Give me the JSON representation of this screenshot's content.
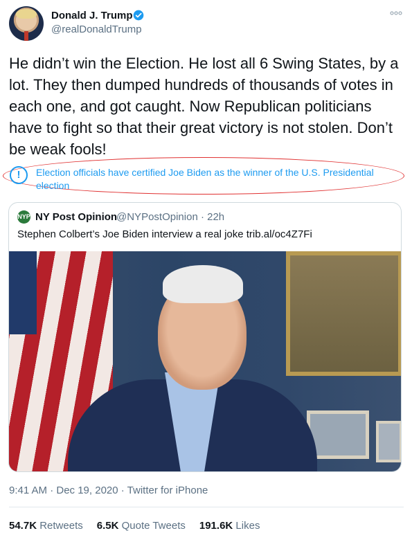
{
  "author": {
    "name": "Donald J. Trump",
    "handle": "@realDonaldTrump",
    "verified": true,
    "avatar_icon": "profile-avatar"
  },
  "more_icon": "more-options-icon",
  "tweet_text": "He didn’t win the Election. He lost all 6 Swing States, by a lot. They then dumped hundreds of thousands of votes in each one, and got caught. Now Republican politicians have to fight so that their great victory is not stolen. Don’t be weak fools!",
  "notice": {
    "icon_glyph": "!",
    "text": "Election officials have certified Joe Biden as the winner of the U.S. Presidential election"
  },
  "quoted": {
    "logo_text": "NYP",
    "name": "NY Post Opinion",
    "handle_time": "@NYPostOpinion · 22h",
    "text": "Stephen Colbert’s Joe Biden interview a real joke trib.al/oc4Z7Fi"
  },
  "meta": "9:41 AM · Dec 19, 2020 · Twitter for iPhone",
  "stats": {
    "retweets_count": "54.7K",
    "retweets_label": "Retweets",
    "quotes_count": "6.5K",
    "quotes_label": "Quote Tweets",
    "likes_count": "191.6K",
    "likes_label": "Likes"
  },
  "colors": {
    "accent": "#1d9bf0",
    "highlight_oval": "#e03030",
    "secondary_text": "#5b7083"
  }
}
